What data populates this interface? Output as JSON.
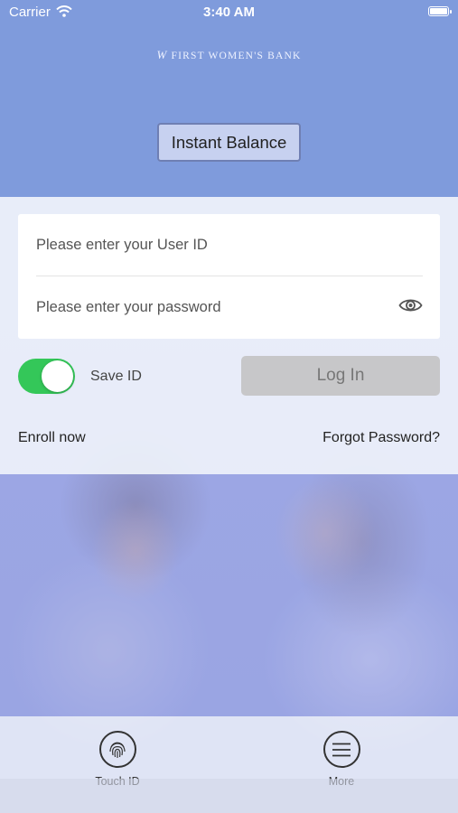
{
  "status_bar": {
    "carrier": "Carrier",
    "time": "3:40 AM"
  },
  "brand": {
    "logo_mark": "W",
    "name": "FIRST WOMEN'S BANK"
  },
  "instant_balance": {
    "label": "Instant Balance"
  },
  "login": {
    "user_id_placeholder": "Please enter your User ID",
    "password_placeholder": "Please enter your password",
    "save_id_label": "Save ID",
    "save_id_on": true,
    "login_button": "Log In",
    "enroll_link": "Enroll now",
    "forgot_link": "Forgot Password?"
  },
  "bottom_bar": {
    "items": [
      {
        "label": "Touch ID",
        "icon": "fingerprint-icon"
      },
      {
        "label": "More",
        "icon": "menu-icon"
      }
    ]
  },
  "colors": {
    "accent": "#7f9bdc",
    "toggle_on": "#34c759",
    "button_disabled": "#c7c7c9"
  }
}
